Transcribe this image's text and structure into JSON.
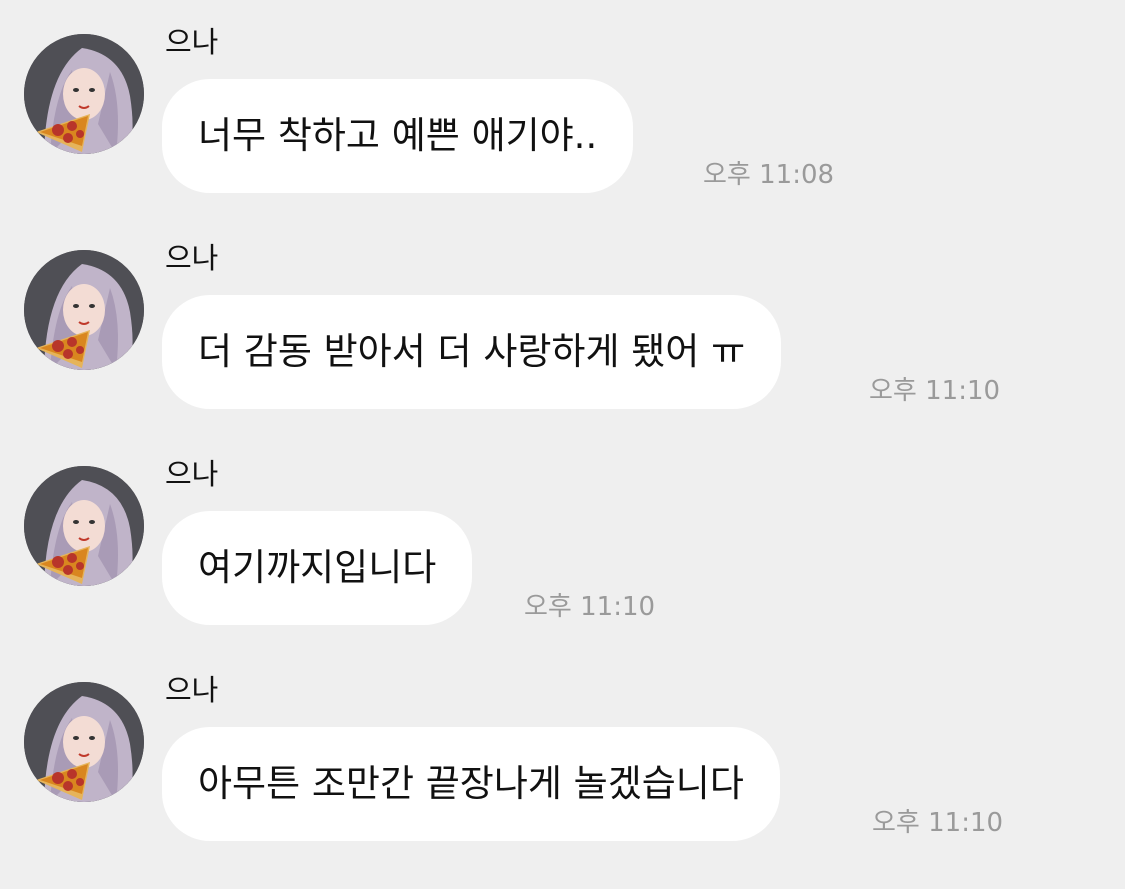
{
  "chat": {
    "background_color": "#efefef",
    "bubble_color": "#ffffff",
    "messages": [
      {
        "sender": "으나",
        "text": "너무 착하고 예쁜 애기야..",
        "time": "오후 11:08",
        "avatar_icon": "profile-photo"
      },
      {
        "sender": "으나",
        "text": "더 감동 받아서 더 사랑하게 됐어 ㅠ",
        "time": "오후 11:10",
        "avatar_icon": "profile-photo"
      },
      {
        "sender": "으나",
        "text": "여기까지입니다",
        "time": "오후 11:10",
        "avatar_icon": "profile-photo"
      },
      {
        "sender": "으나",
        "text": "아무튼 조만간 끝장나게 놀겠습니다",
        "time": "오후 11:10",
        "avatar_icon": "profile-photo"
      }
    ]
  }
}
